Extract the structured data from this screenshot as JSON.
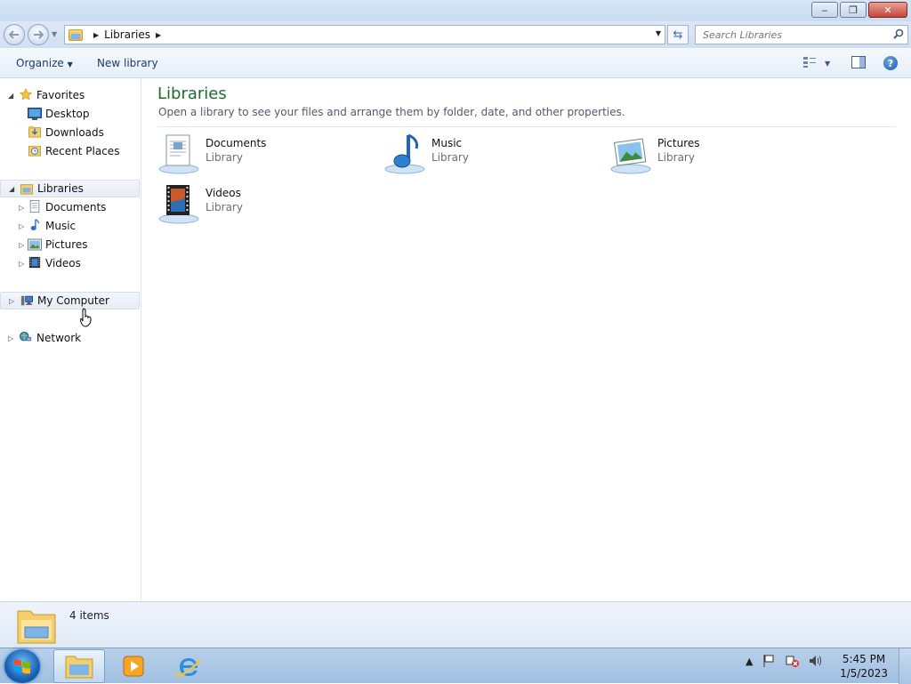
{
  "window": {
    "controls": {
      "minimize": "‒",
      "maximize": "❐",
      "close": "✕"
    }
  },
  "navbar": {
    "back_icon": "back-arrow-icon",
    "forward_icon": "forward-arrow-icon",
    "address": {
      "crumbs": [
        "Libraries"
      ]
    },
    "search": {
      "placeholder": "Search Libraries"
    }
  },
  "toolbar": {
    "organize_label": "Organize",
    "new_library_label": "New library",
    "help_glyph": "?"
  },
  "navpane": {
    "favorites": {
      "label": "Favorites",
      "items": [
        {
          "label": "Desktop"
        },
        {
          "label": "Downloads"
        },
        {
          "label": "Recent Places"
        }
      ]
    },
    "libraries": {
      "label": "Libraries",
      "items": [
        {
          "label": "Documents"
        },
        {
          "label": "Music"
        },
        {
          "label": "Pictures"
        },
        {
          "label": "Videos"
        }
      ]
    },
    "computer": {
      "label": "My Computer"
    },
    "network": {
      "label": "Network"
    }
  },
  "content": {
    "title": "Libraries",
    "description": "Open a library to see your files and arrange them by folder, date, and other properties.",
    "libraries": [
      {
        "name": "Documents",
        "sub": "Library",
        "icon": "documents-library-icon"
      },
      {
        "name": "Music",
        "sub": "Library",
        "icon": "music-library-icon"
      },
      {
        "name": "Pictures",
        "sub": "Library",
        "icon": "pictures-library-icon"
      },
      {
        "name": "Videos",
        "sub": "Library",
        "icon": "videos-library-icon"
      }
    ]
  },
  "details": {
    "count": "4 items"
  },
  "taskbar": {
    "time": "5:45 PM",
    "date": "1/5/2023"
  },
  "colors": {
    "title_green": "#1e6b2f",
    "accent_blue": "#1e395b"
  }
}
